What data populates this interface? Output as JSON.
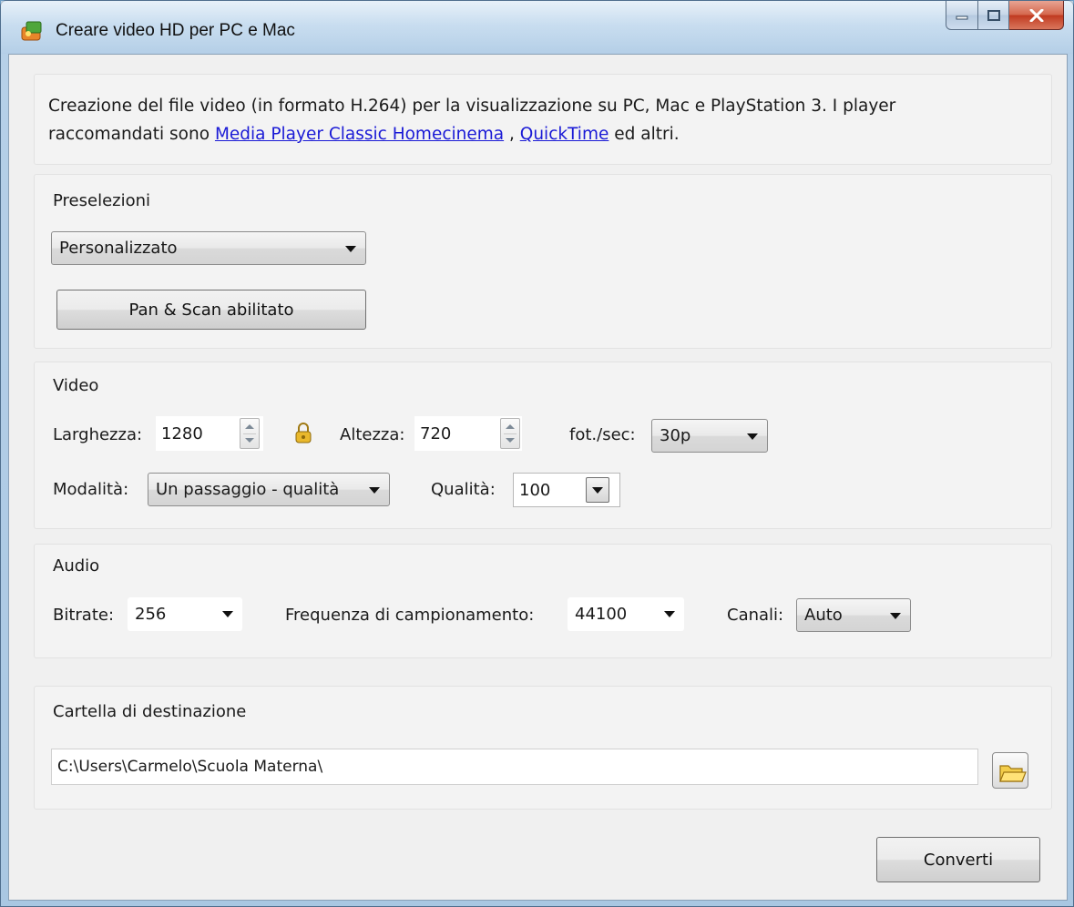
{
  "window": {
    "title": "Creare video HD per PC e Mac"
  },
  "description": {
    "text_before": "Creazione del file video (in formato H.264) per la visualizzazione su PC, Mac e PlayStation 3. I player raccomandati sono ",
    "link1": "Media Player Classic Homecinema",
    "separator": " , ",
    "link2": "QuickTime",
    "text_after": " ed altri."
  },
  "presets": {
    "label": "Preselezioni",
    "selected": "Personalizzato",
    "pan_scan_button": "Pan & Scan abilitato"
  },
  "video": {
    "label": "Video",
    "width_label": "Larghezza:",
    "width_value": "1280",
    "height_label": "Altezza:",
    "height_value": "720",
    "fps_label": "fot./sec:",
    "fps_value": "30p",
    "mode_label": "Modalità:",
    "mode_value": "Un passaggio - qualità",
    "quality_label": "Qualità:",
    "quality_value": "100"
  },
  "audio": {
    "label": "Audio",
    "bitrate_label": "Bitrate:",
    "bitrate_value": "256",
    "sample_label": "Frequenza di campionamento:",
    "sample_value": "44100",
    "channels_label": "Canali:",
    "channels_value": "Auto"
  },
  "destination": {
    "label": "Cartella di destinazione",
    "path": "C:\\Users\\Carmelo\\Scuola Materna\\"
  },
  "actions": {
    "convert": "Converti"
  },
  "icons": {
    "app": "app-icon",
    "minimize": "minimize-icon",
    "maximize": "maximize-icon",
    "close": "close-icon",
    "lock": "lock-icon",
    "folder": "folder-icon"
  },
  "colors": {
    "link": "#1a1ad6",
    "close_button": "#c0391f"
  }
}
